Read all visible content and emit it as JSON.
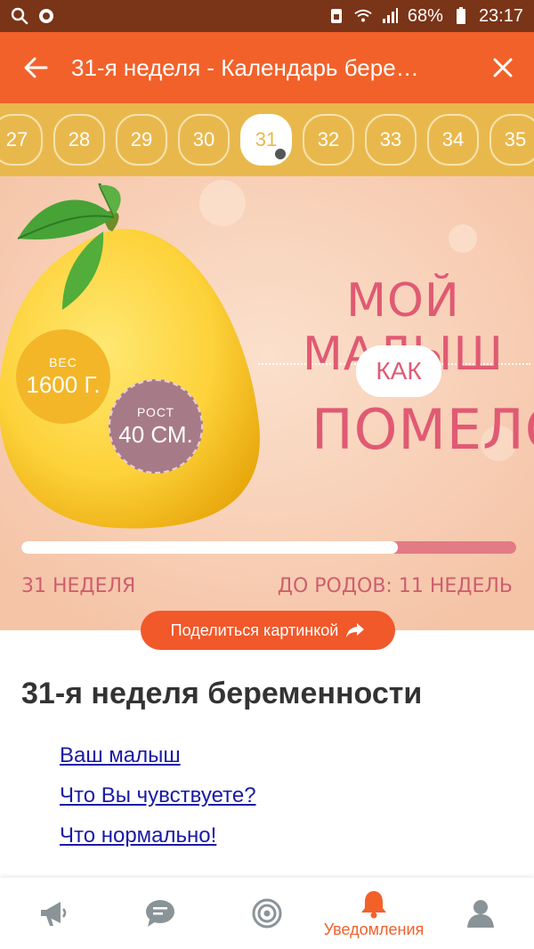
{
  "status_bar": {
    "battery": "68%",
    "time": "23:17"
  },
  "app_bar": {
    "title": "31-я неделя - Календарь бере…"
  },
  "weeks": {
    "items": [
      "27",
      "28",
      "29",
      "30",
      "31",
      "32",
      "33",
      "34",
      "35"
    ],
    "selected": "31"
  },
  "hero": {
    "line1": "МОЙ МАЛЫШ",
    "kak": "КАК",
    "line2": "ПОМЕЛО",
    "weight_label": "ВЕС",
    "weight_value": "1600 Г.",
    "height_label": "РОСТ",
    "height_value": "40 СМ.",
    "week_text": "31 НЕДЕЛЯ",
    "remaining_text": "ДО РОДОВ: 11 НЕДЕЛЬ",
    "progress_fraction": 0.76
  },
  "share_button": {
    "label": "Поделиться картинкой"
  },
  "article": {
    "title": "31-я неделя беременности",
    "links": [
      "Ваш малыш",
      "Что Вы чувствуете?",
      "Что нормально!"
    ]
  },
  "bottom_nav": {
    "items": [
      {
        "icon": "megaphone-icon",
        "label": ""
      },
      {
        "icon": "chat-bubble-icon",
        "label": ""
      },
      {
        "icon": "target-icon",
        "label": ""
      },
      {
        "icon": "bell-icon",
        "label": "Уведомления"
      },
      {
        "icon": "person-icon",
        "label": ""
      }
    ]
  },
  "colors": {
    "accent": "#f2612a",
    "week_strip": "#e9b84d",
    "hero_text": "#e05a73",
    "link": "#1a1aa6"
  }
}
